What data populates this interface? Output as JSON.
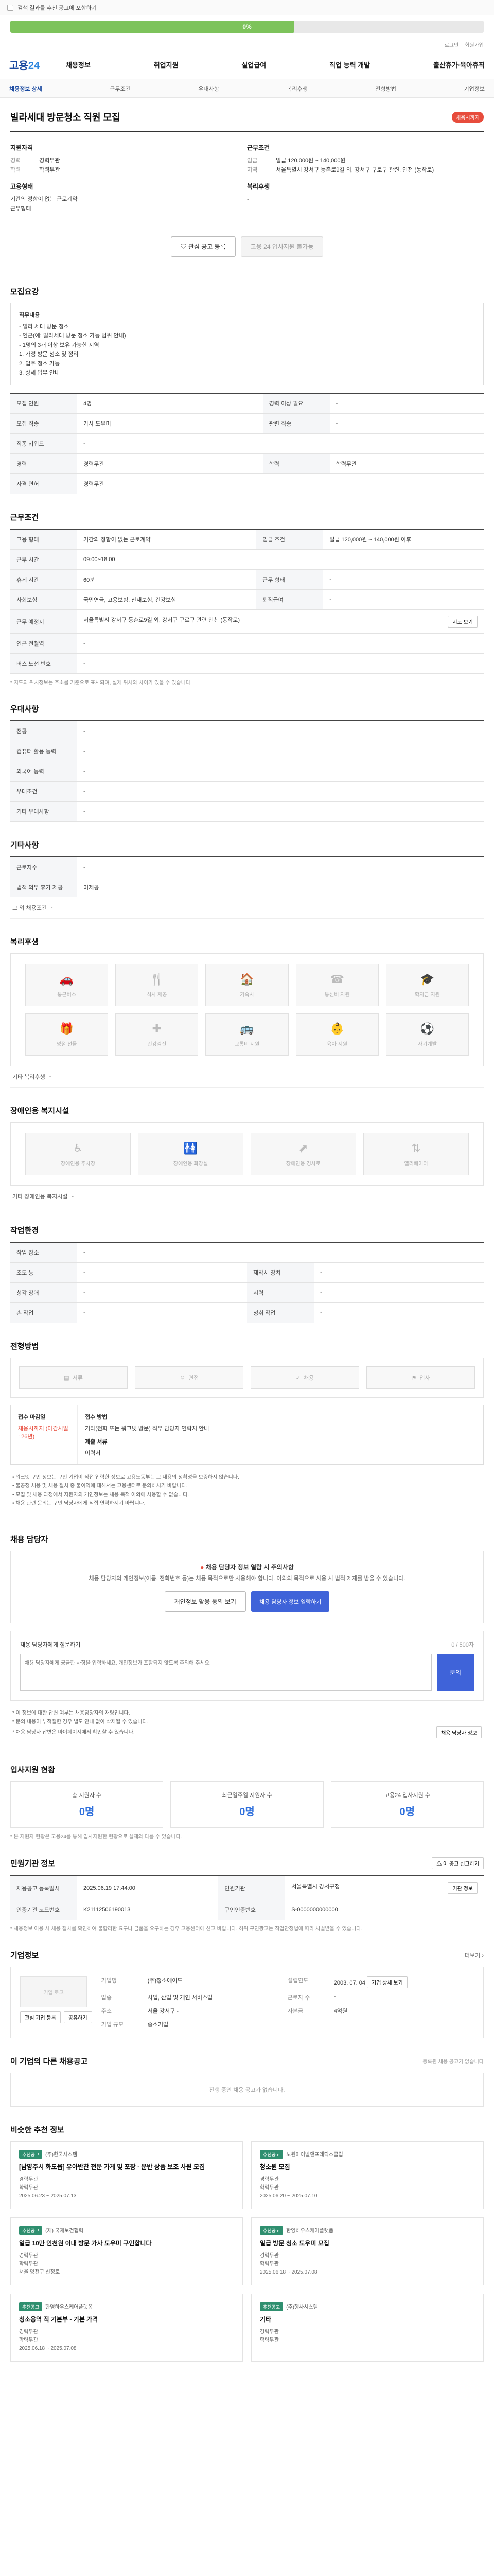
{
  "notice": {
    "text": "검색 결과를 추천 공고에 포함하기"
  },
  "progress": {
    "value": 0.6,
    "label": "0%"
  },
  "util_links": [
    "로그인",
    "회원가입"
  ],
  "brand": {
    "logo_a": "고용",
    "logo_b": "24"
  },
  "gnb": [
    "채용정보",
    "취업지원",
    "실업급여",
    "직업 능력 개발",
    "출산휴가·육아휴직"
  ],
  "subnav": {
    "items": [
      "채용정보 상세",
      "근무조건",
      "우대사항",
      "복리후생",
      "전형방법",
      "기업정보"
    ],
    "active": 0
  },
  "post": {
    "title": "빌라세대 방문청소 직원 모집",
    "badge": "채용시까지"
  },
  "summary": {
    "left_title": "지원자격",
    "left": [
      {
        "k": "경력",
        "v": "경력무관"
      },
      {
        "k": "학력",
        "v": "학력무관"
      }
    ],
    "left_title2": "고용형태",
    "left2": [
      {
        "k": "",
        "v": "기간의 정함이 없는 근로계약"
      },
      {
        "k": "",
        "v": "근무형태"
      }
    ],
    "right_title": "근무조건",
    "right": [
      {
        "k": "임금",
        "v": "일급 120,000원 ~ 140,000원"
      },
      {
        "k": "지역",
        "v": "서울특별시 강서구 등촌로9길 외, 강서구 구로구 관련, 인천 (동작로)"
      }
    ],
    "right_title2": "복리후생",
    "right2": [
      {
        "k": "",
        "v": "-"
      }
    ]
  },
  "actions": {
    "save": "관심 공고 등록",
    "apply": "고용 24 입사지원 불가능"
  },
  "recruit": {
    "title": "모집요강",
    "box_label": "직무내용",
    "box_lines": [
      "- 빌라 세대 방문 청소",
      "- 인근(예: 빌라세대 방문 청소 가능 범위 안내)",
      "- 1명의 3개 이상 보유 가능한 지역",
      "1. 가정 방문 청소 및 정리",
      "2. 입주 청소 가능",
      "3. 상세 업무 안내"
    ],
    "rows": [
      {
        "k": "모집 인원",
        "v": "4명",
        "k2": "경력 이상 필요",
        "v2": "-"
      },
      {
        "k": "모집 직종",
        "v": "가사 도우미",
        "k2": "관련 직종",
        "v2": "-"
      },
      {
        "k": "직종 키워드",
        "v": "-",
        "k2": "",
        "v2": ""
      },
      {
        "k": "경력",
        "v": "경력무관",
        "k2": "학력",
        "v2": "학력무관"
      },
      {
        "k": "자격 면허",
        "v": "경력무관",
        "k2": "",
        "v2": ""
      }
    ]
  },
  "conditions": {
    "title": "근무조건",
    "rows": [
      {
        "k": "고용 형태",
        "v": "기간의 정함이 없는 근로계약",
        "k2": "임금 조건",
        "v2": "일급 120,000원 ~ 140,000원 이후"
      },
      {
        "k": "근무 시간",
        "v": "09:00~18:00",
        "k2": "",
        "v2": ""
      },
      {
        "k": "휴게 시간",
        "v": "60분",
        "k2": "근무 형태",
        "v2": "-"
      },
      {
        "k": "사회보험",
        "v": "국민연금, 고용보험, 산재보험, 건강보험",
        "k2": "퇴직급여",
        "v2": "-"
      },
      {
        "k": "근무 예정지",
        "v": "서울특별시 강서구 등촌로9길 외, 강서구 구로구 관련 인천 (동작로)",
        "k2": "",
        "v2": ""
      },
      {
        "k": "인근 전철역",
        "v": "-",
        "k2": "",
        "v2": ""
      },
      {
        "k": "버스 노선 번호",
        "v": "-",
        "k2": "",
        "v2": ""
      }
    ],
    "map_btn": "지도 보기",
    "note": "* 지도의 위치정보는 주소를 기준으로 표시되며, 실제 위치와 차이가 있을 수 있습니다."
  },
  "preferred": {
    "title": "우대사항",
    "rows": [
      {
        "k": "전공",
        "v": "-"
      },
      {
        "k": "컴퓨터 활용 능력",
        "v": "-"
      },
      {
        "k": "외국어 능력",
        "v": "-"
      },
      {
        "k": "우대조건",
        "v": "-"
      },
      {
        "k": "기타 우대사항",
        "v": "-"
      }
    ]
  },
  "other": {
    "title": "기타사항",
    "rows": [
      {
        "k": "근로자수",
        "v": "-"
      },
      {
        "k": "법적 의무 휴가 제공",
        "v": "미제공"
      }
    ],
    "extra_label": "그 외 채용조건",
    "extra_value": "-"
  },
  "welfare": {
    "title": "복리후생",
    "cards": [
      {
        "icon": "car-icon",
        "glyph": "🚗",
        "label": "통근버스"
      },
      {
        "icon": "meal-icon",
        "glyph": "🍴",
        "label": "식사 제공"
      },
      {
        "icon": "house-icon",
        "glyph": "🏠",
        "label": "기숙사"
      },
      {
        "icon": "phone-icon",
        "glyph": "☎",
        "label": "통신비 지원"
      },
      {
        "icon": "graduation-icon",
        "glyph": "🎓",
        "label": "학자금 지원"
      },
      {
        "icon": "gift-icon",
        "glyph": "🎁",
        "label": "명절 선물"
      },
      {
        "icon": "medical-icon",
        "glyph": "✚",
        "label": "건강검진"
      },
      {
        "icon": "bus-icon",
        "glyph": "🚌",
        "label": "교통비 지원"
      },
      {
        "icon": "child-icon",
        "glyph": "👶",
        "label": "육아 지원"
      },
      {
        "icon": "sport-icon",
        "glyph": "⚽",
        "label": "자기계발"
      }
    ],
    "extra_label": "기타 복리후생",
    "extra_value": "-"
  },
  "disability": {
    "title": "장애인용 복지시설",
    "cards": [
      {
        "icon": "wheelchair-icon",
        "glyph": "♿",
        "label": "장애인용 주차장"
      },
      {
        "icon": "toilet-icon",
        "glyph": "🚻",
        "label": "장애인용 화장실"
      },
      {
        "icon": "ramp-icon",
        "glyph": "⬈",
        "label": "장애인용 경사로"
      },
      {
        "icon": "elevator-icon",
        "glyph": "⇅",
        "label": "엘리베이터"
      }
    ],
    "extra_label": "기타 장애인용 복지시설",
    "extra_value": "-"
  },
  "work_env": {
    "title": "작업환경",
    "rows": [
      {
        "k": "작업 장소",
        "v": "-",
        "k2": "",
        "v2": ""
      },
      {
        "k": "조도 등",
        "v": "-",
        "k2": "제작시 장치",
        "v2": "-"
      },
      {
        "k": "청각 장애",
        "v": "-",
        "k2": "시력",
        "v2": "-"
      },
      {
        "k": "손 작업",
        "v": "-",
        "k2": "청취 작업",
        "v2": "-"
      }
    ]
  },
  "selection": {
    "title": "전형방법",
    "steps": [
      "서류",
      "면접",
      "채용",
      "입사"
    ],
    "doc_label": "접수 마감일",
    "doc_value": "채용시까지 (마감시일 : 26년)",
    "method_label": "접수 방법",
    "method_value": "기타(전화 또는 워크넷 방문) 직무 담당자 연락처 안내",
    "extra_label": "제출 서류",
    "extra_value": "이력서",
    "bullets": [
      "• 워크넷 구인 정보는 구인 기업이 직접 입력한 정보로 고용노동부는 그 내용의 정확성을 보증하지 않습니다.",
      "• 불공정 채용 및 채용 절차 중 불이익에 대해서는 고용센터로 문의하시기 바랍니다.",
      "• 모집 및 채용 과정에서 지원자의 개인정보는 채용 목적 이외에 사용할 수 없습니다.",
      "• 채용 관련 문의는 구인 담당자에게 직접 연락하시기 바랍니다."
    ]
  },
  "manager": {
    "title": "채용 담당자",
    "msg": "채용 담당자 정보 열람 시 주의사항",
    "sub": "채용 담당자의 개인정보(이름, 전화번호 등)는 채용 목적으로만 사용해야 합니다. 이외의 목적으로 사용 시 법적 제재를 받을 수 있습니다.",
    "btn1": "개인정보 활용 동의 보기",
    "btn2": "채용 담당자 정보 열람하기",
    "qna_title": "채용 담당자에게 질문하기",
    "qna_right": "0 / 500자",
    "qna_placeholder": "채용 담당자에게 궁금한 사항을 입력하세요. 개인정보가 포함되지 않도록 주의해 주세요.",
    "qna_btn": "문의",
    "notes": [
      "* 이 정보에 대한 답변 여부는 채용담당자의 재량입니다.",
      "* 문의 내용이 부적절한 경우 별도 안내 없이 삭제될 수 있습니다.",
      "* 채용 담당자 답변은 마이페이지에서 확인할 수 있습니다."
    ],
    "notes_btn": "채용 담당자 정보"
  },
  "stats": {
    "title": "입사지원 현황",
    "items": [
      {
        "t": "총 지원자 수",
        "n": "0명"
      },
      {
        "t": "최근일주일 지원자 수",
        "n": "0명"
      },
      {
        "t": "고용24 입사지원 수",
        "n": "0명"
      }
    ],
    "note": "* 본 지원자 현황은 고용24를 통해 입사지원한 현황으로 실제와 다를 수 있습니다."
  },
  "jobinfo": {
    "title": "민원기관 정보",
    "btn": "이 공고 신고하기",
    "rows": [
      {
        "k": "채용공고 등록일시",
        "v": "2025.06.19 17:44:00",
        "k2": "민원기관",
        "v2": "서울특별시 강서구청",
        "btn": "기관 정보"
      },
      {
        "k": "인증기관 코드번호",
        "v": "K21112506190013",
        "k2": "구인인증번호",
        "v2": "S-0000000000000"
      }
    ],
    "note": "* 채용정보 이용 시 채용 절차를 확인하여 불합리한 요구나 금품을 요구하는 경우 고용센터에 신고 바랍니다. 허위 구인광고는 직업안정법에 따라 처벌받을 수 있습니다."
  },
  "company": {
    "title": "기업정보",
    "more": "더보기",
    "logo_placeholder": "기업 로고",
    "fav_btn": "관심 기업 등록",
    "share_btn": "공유하기",
    "grid": [
      {
        "k": "기업명",
        "v": "(주)청소에이드"
      },
      {
        "k": "설립연도",
        "v": "2003. 07. 04"
      },
      {
        "k": "업종",
        "v": "사업, 산업 및 개인 서비스업"
      },
      {
        "k": "근로자 수",
        "v": "-"
      },
      {
        "k": "주소",
        "v": "서울 강서구 -"
      },
      {
        "k": "자본금",
        "v": "4억원"
      },
      {
        "k": "기업 규모",
        "v": "중소기업"
      },
      {
        "k": "",
        "v": ""
      }
    ],
    "btn_detail": "기업 상세 보기"
  },
  "related": {
    "title": "이 기업의 다른 채용공고",
    "right": "등록된 채용 공고가 없습니다",
    "empty": "진행 중인 채용 공고가 없습니다."
  },
  "recommend": {
    "title": "비슷한 추천 정보",
    "jobs": [
      {
        "tag": "추천공고",
        "comp": "(주)한국시스템",
        "title": "[남양주시 화도읍] 유아반찬 전문 가게 및 포장 · 운반 상품 보조 사원 모집",
        "meta": [
          "경력무관",
          "학력무관",
          "2025.06.23 ~ 2025.07.13"
        ]
      },
      {
        "tag": "추천공고",
        "comp": "노원마이벨앤프레딕스클럽",
        "title": "청소원 모집",
        "meta": [
          "경력무관",
          "학력무관",
          "2025.06.20 ~ 2025.07.10"
        ]
      },
      {
        "tag": "추천공고",
        "comp": "(재) 국제보건협력",
        "title": "일급 10만 인천원 이내 방문 가사 도우미 구인합니다",
        "meta": [
          "경력무관",
          "학력무관",
          "서울 양천구 신정로"
        ]
      },
      {
        "tag": "추천공고",
        "comp": "한영하우스케어플랫폼",
        "title": "일급 방문 청소 도우미 모집",
        "meta": [
          "경력무관",
          "학력무관",
          "2025.06.18 ~ 2025.07.08"
        ]
      },
      {
        "tag": "추천공고",
        "comp": "한영하우스케어플랫폼",
        "title": "청소용역 직 기본부 - 기본 가격",
        "meta": [
          "경력무관",
          "학력무관",
          "2025.06.18 ~ 2025.07.08"
        ]
      },
      {
        "tag": "추천공고",
        "comp": "(주)행사시스템",
        "title": "기타",
        "meta": [
          "경력무관",
          "학력무관"
        ]
      }
    ]
  }
}
